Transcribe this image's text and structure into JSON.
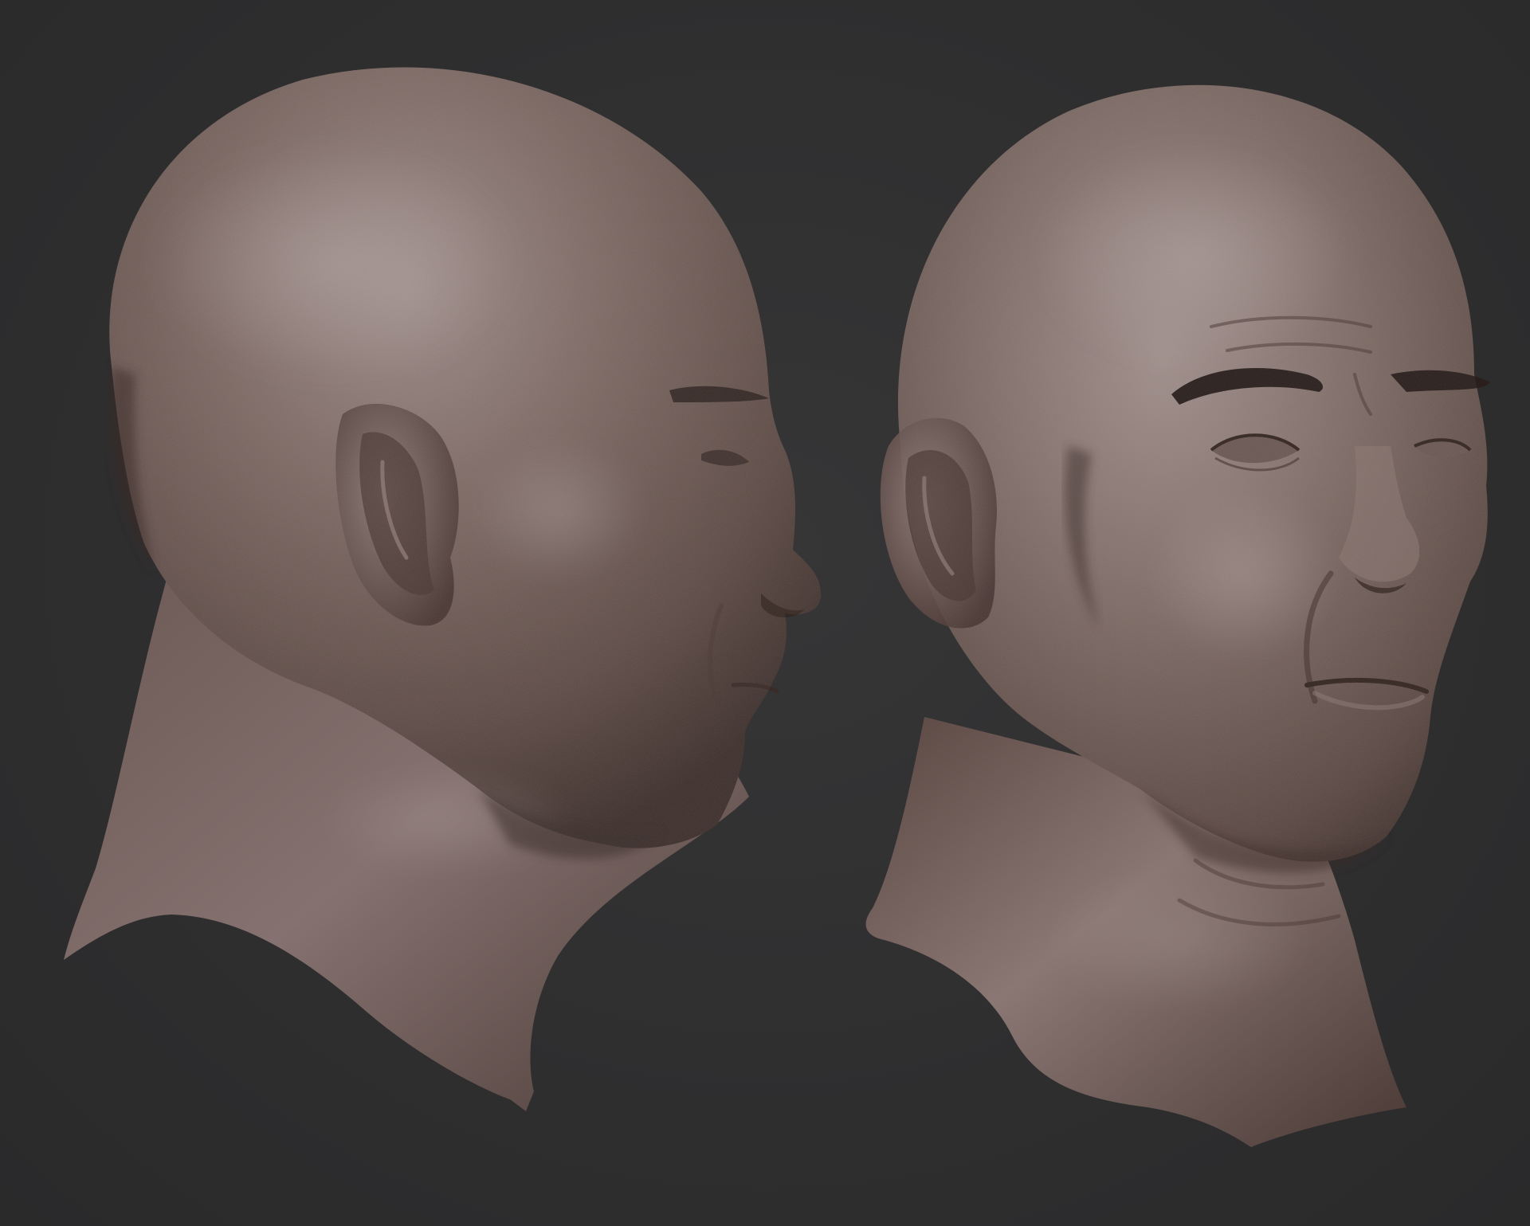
{
  "scene": {
    "views": [
      "profile-view",
      "three-quarter-view"
    ],
    "colors": {
      "background": "#2f2f30",
      "skin_light": "#9b8a86",
      "skin_mid": "#6e5b56",
      "skin_dark": "#3f302c",
      "brow": "#2a1f1c"
    }
  }
}
